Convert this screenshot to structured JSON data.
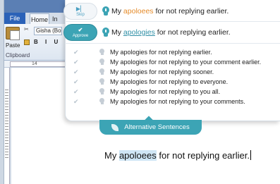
{
  "word": {
    "tab_file": "File",
    "tab_home": "Home",
    "tab_insert": "In",
    "font_name": "Gisha (Bo",
    "paste_label": "Paste",
    "format_buttons": "B I U",
    "clipboard_label": "Clipboard",
    "ruler_mark": "14"
  },
  "popup": {
    "skip_label": "Skip",
    "approve_label": "Approve",
    "original": {
      "prefix": "My ",
      "error_word": "apoloees",
      "suffix": " for not replying earlier."
    },
    "correction": {
      "prefix": "My ",
      "fixed_word": "apologies",
      "suffix": " for not replying earlier."
    },
    "alternatives": [
      "My apologies for not replying earlier.",
      "My apologies for not replying to your comment earlier.",
      "My apologies for not replying sooner.",
      "My apologies for not replying to everyone.",
      "My apologies for not replying to you all.",
      "My apologies for not replying to your comments."
    ],
    "alt_tab_label": "Alternative Sentences"
  },
  "document": {
    "prefix": "My ",
    "error_word": "apoloees",
    "suffix": " for not replying earlier."
  },
  "colors": {
    "accent": "#3ca4b5",
    "error": "#e58b2a",
    "fix": "#2f8fa6"
  }
}
